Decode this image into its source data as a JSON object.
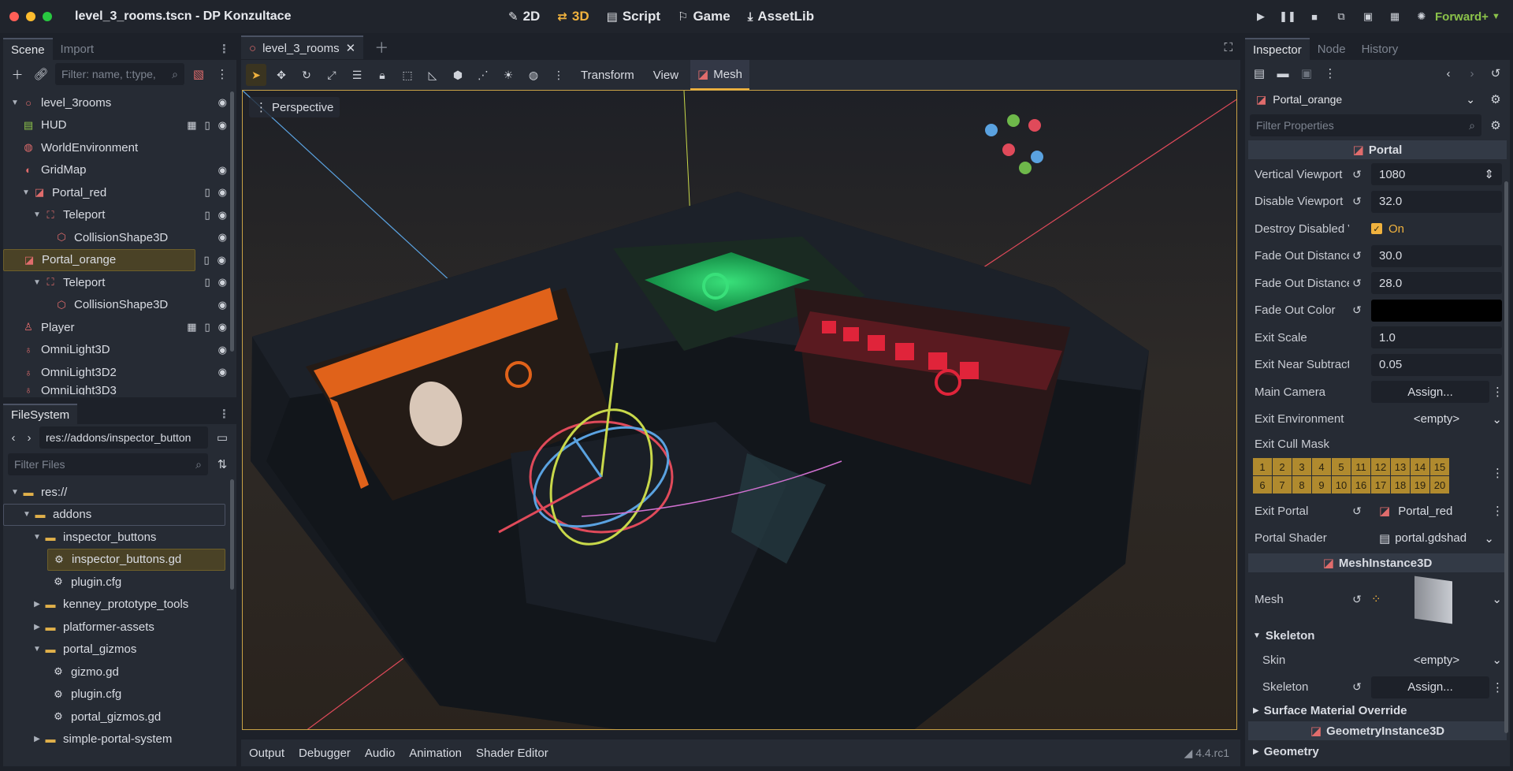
{
  "window": {
    "title": "level_3_rooms.tscn - DP Konzultace"
  },
  "main_modes": [
    {
      "label": "2D",
      "icon": "2d-icon"
    },
    {
      "label": "3D",
      "icon": "3d-icon"
    },
    {
      "label": "Script",
      "icon": "script-icon"
    },
    {
      "label": "Game",
      "icon": "game-icon"
    },
    {
      "label": "AssetLib",
      "icon": "assetlib-icon"
    }
  ],
  "renderer": "Forward+",
  "scene_dock": {
    "tabs": [
      "Scene",
      "Import"
    ],
    "filter_placeholder": "Filter: name, t:type,",
    "nodes": [
      {
        "label": "level_3rooms"
      },
      {
        "label": "HUD"
      },
      {
        "label": "WorldEnvironment"
      },
      {
        "label": "GridMap"
      },
      {
        "label": "Portal_red"
      },
      {
        "label": "Teleport"
      },
      {
        "label": "CollisionShape3D"
      },
      {
        "label": "Portal_orange"
      },
      {
        "label": "Teleport"
      },
      {
        "label": "CollisionShape3D"
      },
      {
        "label": "Player"
      },
      {
        "label": "OmniLight3D"
      },
      {
        "label": "OmniLight3D2"
      },
      {
        "label": "OmniLight3D3"
      }
    ]
  },
  "filesystem": {
    "tab": "FileSystem",
    "path": "res://addons/inspector_button",
    "filter_placeholder": "Filter Files",
    "items": [
      {
        "label": "res://"
      },
      {
        "label": "addons"
      },
      {
        "label": "inspector_buttons"
      },
      {
        "label": "inspector_buttons.gd"
      },
      {
        "label": "plugin.cfg"
      },
      {
        "label": "kenney_prototype_tools"
      },
      {
        "label": "platformer-assets"
      },
      {
        "label": "portal_gizmos"
      },
      {
        "label": "gizmo.gd"
      },
      {
        "label": "plugin.cfg"
      },
      {
        "label": "portal_gizmos.gd"
      },
      {
        "label": "simple-portal-system"
      }
    ]
  },
  "editor": {
    "scene_tab": "level_3_rooms",
    "menus": [
      "Transform",
      "View",
      "Mesh"
    ],
    "perspective": "Perspective",
    "bottom_tabs": [
      "Output",
      "Debugger",
      "Audio",
      "Animation",
      "Shader Editor"
    ],
    "version": "4.4.rc1"
  },
  "inspector": {
    "tabs": [
      "Inspector",
      "Node",
      "History"
    ],
    "object": "Portal_orange",
    "filter_placeholder": "Filter Properties",
    "section_portal": "Portal",
    "props": [
      {
        "label": "Vertical Viewport",
        "value": "1080"
      },
      {
        "label": "Disable Viewport",
        "value": "32.0"
      },
      {
        "label": "Destroy Disabled Vie",
        "value": "On"
      },
      {
        "label": "Fade Out Distance",
        "value": "30.0"
      },
      {
        "label": "Fade Out Distance",
        "value": "28.0"
      },
      {
        "label": "Fade Out Color",
        "value": ""
      },
      {
        "label": "Exit Scale",
        "value": "1.0"
      },
      {
        "label": "Exit Near Subtract",
        "value": "0.05"
      },
      {
        "label": "Main Camera",
        "value": "Assign..."
      },
      {
        "label": "Exit Environment",
        "value": "<empty>"
      },
      {
        "label": "Exit Cull Mask",
        "value": ""
      }
    ],
    "cull_mask": [
      "1",
      "2",
      "3",
      "4",
      "5",
      "11",
      "12",
      "13",
      "14",
      "15",
      "6",
      "7",
      "8",
      "9",
      "10",
      "16",
      "17",
      "18",
      "19",
      "20"
    ],
    "exit_portal": {
      "label": "Exit Portal",
      "value": "Portal_red"
    },
    "portal_shader": {
      "label": "Portal Shader",
      "value": "portal.gdshad"
    },
    "section_mesh": "MeshInstance3D",
    "mesh_label": "Mesh",
    "skeleton_group": "Skeleton",
    "skin": {
      "label": "Skin",
      "value": "<empty>"
    },
    "skeleton": {
      "label": "Skeleton",
      "value": "Assign..."
    },
    "surface_override": "Surface Material Override",
    "section_geometry": "GeometryInstance3D",
    "geometry_group": "Geometry"
  },
  "colors": {
    "accent": "#f0b23e",
    "selection": "#4a4226",
    "panel": "#262b34",
    "background": "#1d2129",
    "renderer": "#8bc24a"
  }
}
